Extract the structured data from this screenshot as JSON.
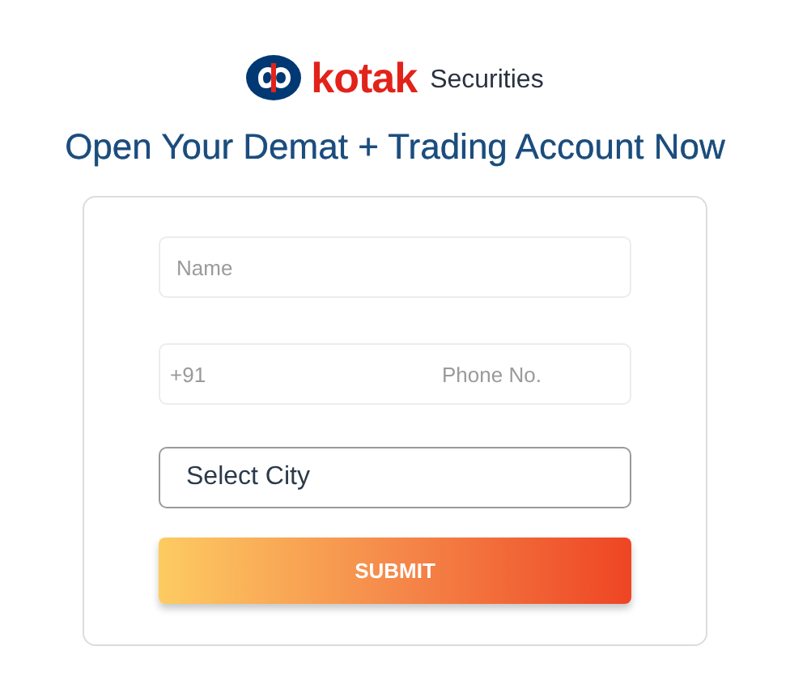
{
  "logo": {
    "brand": "kotak",
    "suffix": "Securities"
  },
  "heading": "Open Your Demat + Trading Account Now",
  "form": {
    "name": {
      "placeholder": "Name"
    },
    "phone": {
      "country_code": "+91",
      "placeholder": "Phone No."
    },
    "city": {
      "value": "Select City"
    },
    "submit": "SUBMIT"
  }
}
